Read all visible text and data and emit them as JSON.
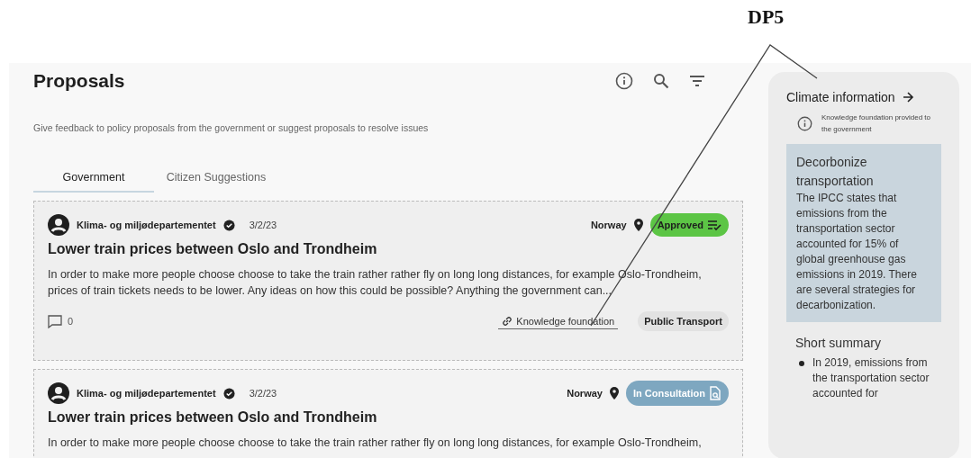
{
  "annotation": {
    "label": "DP5"
  },
  "header": {
    "title": "Proposals",
    "subtitle": "Give feedback to policy proposals from the government or suggest proposals to resolve issues"
  },
  "tabs": [
    {
      "label": "Government",
      "selected": true
    },
    {
      "label": "Citizen Suggestions",
      "selected": false
    }
  ],
  "proposals": [
    {
      "author": "Klima- og miljødepartementet",
      "verified": true,
      "date": "3/2/23",
      "location": "Norway",
      "status": {
        "kind": "approved",
        "label": "Approved"
      },
      "title": "Lower train prices between Oslo and Trondheim",
      "description": [
        "In order to make more people choose choose to take the train rather rather fly on long long distances, for example Oslo-Trondheim,",
        "prices of train tickets needs to be lower. Any ideas on how this could be possible? Anything the government can..."
      ],
      "comments": "0",
      "link": "Knowledge foundation",
      "tag": "Public Transport"
    },
    {
      "author": "Klima- og miljødepartementet",
      "verified": true,
      "date": "3/2/23",
      "location": "Norway",
      "status": {
        "kind": "consultation",
        "label": "In Consultation"
      },
      "title": "Lower train prices between Oslo and Trondheim",
      "description": [
        "In order to make more people choose choose to take the train rather rather fly on long long distances, for example Oslo-Trondheim,"
      ]
    }
  ],
  "sidebar": {
    "title": "Climate information",
    "note": "Knowledge foundation provided to the government",
    "highlight": {
      "title": "Decorbonize transportation",
      "body": "The IPCC states that emissions from the transportation sector accounted for 15% of global greenhouse gas emissions in 2019. There are several strategies for decarbonization."
    },
    "summary_title": "Short summary",
    "summary": [
      "In 2019, emissions from the transportation sector accounted for"
    ]
  }
}
